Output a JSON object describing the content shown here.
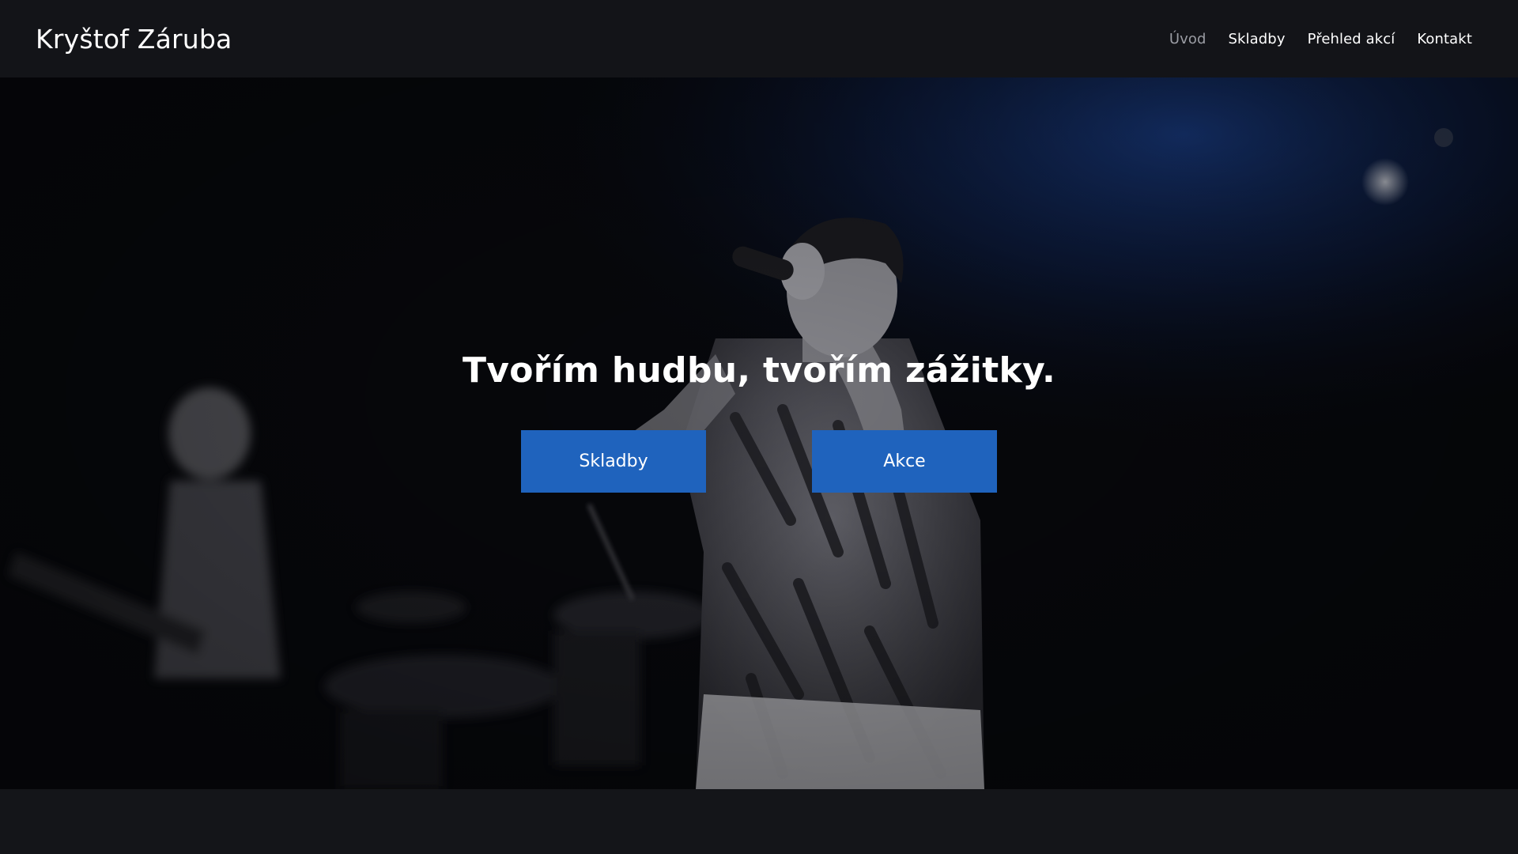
{
  "header": {
    "brand": "Kryštof Záruba",
    "nav": [
      {
        "label": "Úvod",
        "active": true
      },
      {
        "label": "Skladby",
        "active": false
      },
      {
        "label": "Přehled akcí",
        "active": false
      },
      {
        "label": "Kontakt",
        "active": false
      }
    ]
  },
  "hero": {
    "title": "Tvořím hudbu, tvořím zážitky.",
    "buttons": {
      "primary": "Skladby",
      "secondary": "Akce"
    },
    "photo": "concert-singer-with-microphone"
  },
  "colors": {
    "accent": "#1f63bd",
    "header_bg": "#131418",
    "nav_active": "#9a9ca3"
  }
}
